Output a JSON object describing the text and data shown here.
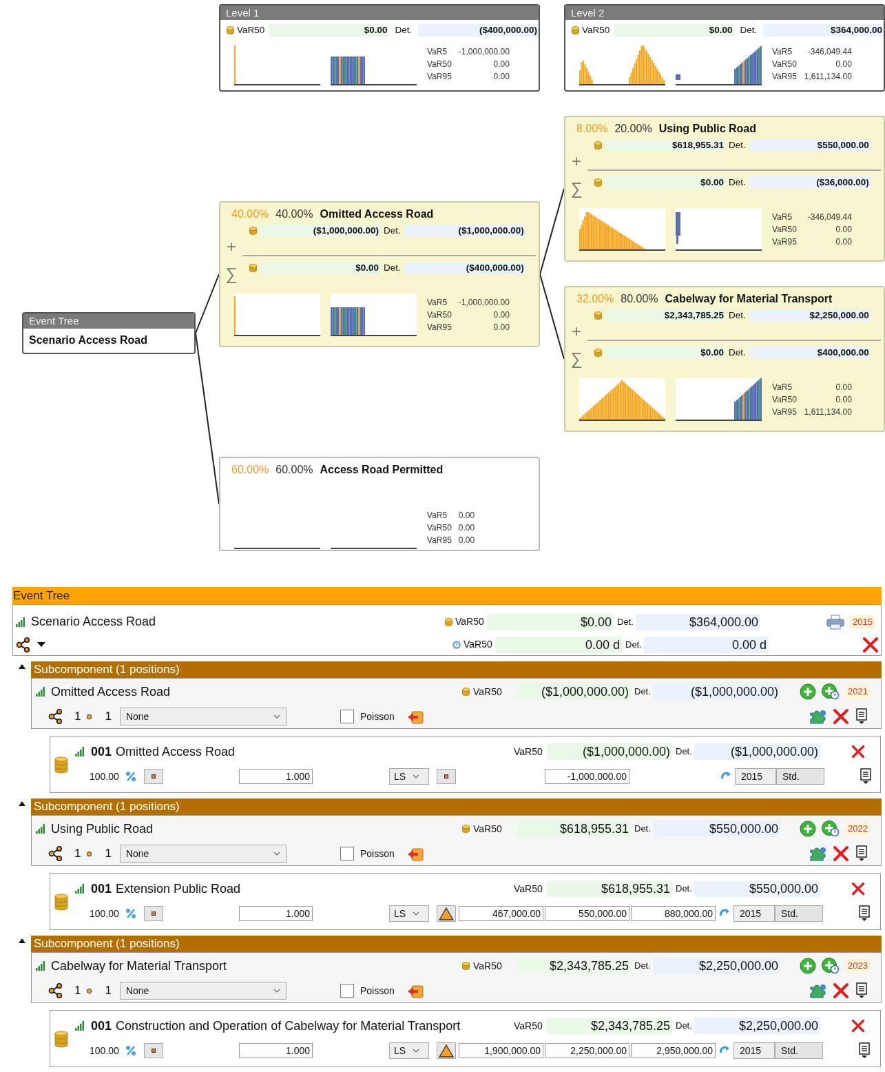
{
  "diagram": {
    "levels": [
      {
        "title": "Level 1",
        "measure": "VaR50",
        "value": "$0.00",
        "det_label": "Det.",
        "det_value": "($400,000.00)",
        "stats": [
          {
            "label": "VaR5",
            "value": "-1,000,000.00"
          },
          {
            "label": "VaR50",
            "value": "0.00"
          },
          {
            "label": "VaR95",
            "value": "0.00"
          }
        ]
      },
      {
        "title": "Level 2",
        "measure": "VaR50",
        "value": "$0.00",
        "det_label": "Det.",
        "det_value": "$364,000.00",
        "stats": [
          {
            "label": "VaR5",
            "value": "-346,049.44"
          },
          {
            "label": "VaR50",
            "value": "0.00"
          },
          {
            "label": "VaR95",
            "value": "1,611,134.00"
          }
        ]
      }
    ],
    "root": {
      "header": "Event Tree",
      "name": "Scenario Access Road",
      "children": [
        {
          "kind": "detailed",
          "cum_prob": "40.00%",
          "prob": "40.00%",
          "name": "Omitted Access Road",
          "rows": [
            {
              "symbol": "+",
              "value": "($1,000,000.00)",
              "det_label": "Det.",
              "det_value": "($1,000,000.00)"
            },
            {
              "symbol": "∑",
              "value": "$0.00",
              "det_label": "Det.",
              "det_value": "($400,000.00)"
            }
          ],
          "stats": [
            {
              "label": "VaR5",
              "value": "-1,000,000.00"
            },
            {
              "label": "VaR50",
              "value": "0.00"
            },
            {
              "label": "VaR95",
              "value": "0.00"
            }
          ],
          "children": [
            {
              "kind": "detailed",
              "cum_prob": "8.00%",
              "prob": "20.00%",
              "name": "Using Public Road",
              "rows": [
                {
                  "symbol": "+",
                  "value": "$618,955.31",
                  "det_label": "Det.",
                  "det_value": "$550,000.00"
                },
                {
                  "symbol": "∑",
                  "value": "$0.00",
                  "det_label": "Det.",
                  "det_value": "($36,000.00)"
                }
              ],
              "stats": [
                {
                  "label": "VaR5",
                  "value": "-346,049.44"
                },
                {
                  "label": "VaR50",
                  "value": "0.00"
                },
                {
                  "label": "VaR95",
                  "value": "0.00"
                }
              ]
            },
            {
              "kind": "detailed",
              "cum_prob": "32.00%",
              "prob": "80.00%",
              "name": "Cabelway for Material Transport",
              "rows": [
                {
                  "symbol": "+",
                  "value": "$2,343,785.25",
                  "det_label": "Det.",
                  "det_value": "$2,250,000.00"
                },
                {
                  "symbol": "∑",
                  "value": "$0.00",
                  "det_label": "Det.",
                  "det_value": "$400,000.00"
                }
              ],
              "stats": [
                {
                  "label": "VaR5",
                  "value": "0.00"
                },
                {
                  "label": "VaR50",
                  "value": "0.00"
                },
                {
                  "label": "VaR95",
                  "value": "1,611,134.00"
                }
              ]
            }
          ]
        },
        {
          "kind": "empty",
          "cum_prob": "60.00%",
          "prob": "60.00%",
          "name": "Access Road Permitted",
          "stats": [
            {
              "label": "VaR5",
              "value": "0.00"
            },
            {
              "label": "VaR50",
              "value": "0.00"
            },
            {
              "label": "VaR95",
              "value": "0.00"
            }
          ]
        }
      ]
    }
  },
  "editor": {
    "title": "Event Tree",
    "scenario": {
      "name": "Scenario Access Road",
      "year": "2015",
      "measures": [
        {
          "label": "VaR50",
          "value": "$0.00",
          "det_label": "Det.",
          "det_value": "$364,000.00"
        },
        {
          "label": "VaR50",
          "value": "0.00 d",
          "det_label": "Det.",
          "det_value": "0.00 d"
        }
      ]
    },
    "subcomponents": [
      {
        "title": "Subcomponent (1 positions)",
        "expanded": true,
        "name": "Omitted Access Road",
        "measure": "VaR50",
        "value": "($1,000,000.00)",
        "det_label": "Det.",
        "det_value": "($1,000,000.00)",
        "year": "2021",
        "branches": "1",
        "events": "1",
        "selector": "None",
        "poisson": {
          "label": "Poisson",
          "checked": false
        },
        "positions": [
          {
            "number": "001",
            "name": "Omitted Access Road",
            "measure": "VaR50",
            "value": "($1,000,000.00)",
            "det_label": "Det.",
            "det_value": "($1,000,000.00)",
            "share": "100.00",
            "quantity": "1.000",
            "unit": "LS",
            "kind": "point",
            "estimates": [
              "-1,000,000.00"
            ],
            "year": "2015",
            "mode": "Std."
          }
        ]
      },
      {
        "title": "Subcomponent (1 positions)",
        "expanded": true,
        "name": "Using Public Road",
        "measure": "VaR50",
        "value": "$618,955.31",
        "det_label": "Det.",
        "det_value": "$550,000.00",
        "year": "2022",
        "branches": "1",
        "events": "1",
        "selector": "None",
        "poisson": {
          "label": "Poisson",
          "checked": false
        },
        "positions": [
          {
            "number": "001",
            "name": "Extension Public Road",
            "measure": "VaR50",
            "value": "$618,955.31",
            "det_label": "Det.",
            "det_value": "$550,000.00",
            "share": "100.00",
            "quantity": "1.000",
            "unit": "LS",
            "kind": "triangular",
            "estimates": [
              "467,000.00",
              "550,000.00",
              "880,000.00"
            ],
            "year": "2015",
            "mode": "Std."
          }
        ]
      },
      {
        "title": "Subcomponent (1 positions)",
        "expanded": true,
        "name": "Cabelway for Material Transport",
        "measure": "VaR50",
        "value": "$2,343,785.25",
        "det_label": "Det.",
        "det_value": "$2,250,000.00",
        "year": "2023",
        "branches": "1",
        "events": "1",
        "selector": "None",
        "poisson": {
          "label": "Poisson",
          "checked": false
        },
        "positions": [
          {
            "number": "001",
            "name": "Construction and Operation of Cabelway for Material Transport",
            "measure": "VaR50",
            "value": "$2,343,785.25",
            "det_label": "Det.",
            "det_value": "$2,250,000.00",
            "share": "100.00",
            "quantity": "1.000",
            "unit": "LS",
            "kind": "triangular",
            "estimates": [
              "1,900,000.00",
              "2,250,000.00",
              "2,950,000.00"
            ],
            "year": "2015",
            "mode": "Std."
          }
        ]
      }
    ]
  }
}
